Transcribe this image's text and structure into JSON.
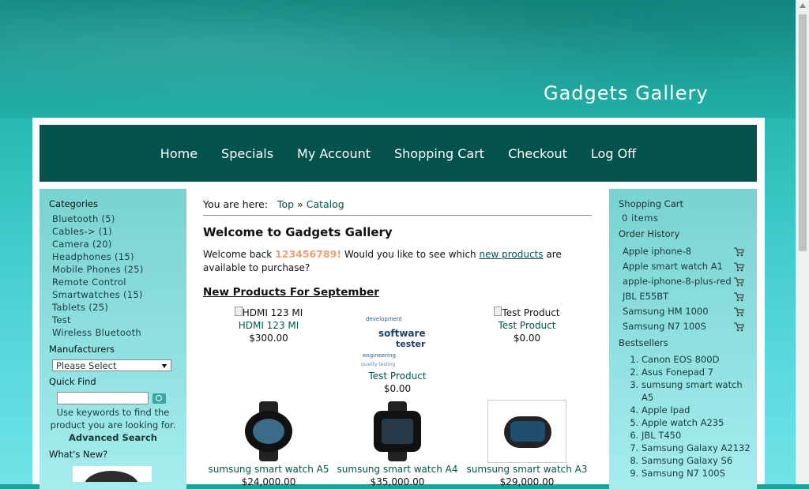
{
  "site": {
    "title": "Gadgets Gallery"
  },
  "nav": [
    "Home",
    "Specials",
    "My Account",
    "Shopping Cart",
    "Checkout",
    "Log Off"
  ],
  "left": {
    "categories_title": "Categories",
    "categories": [
      "Bluetooth (5)",
      "Cables-> (1)",
      "Camera (20)",
      "Headphones (15)",
      "Mobile Phones (25)",
      "Remote Control",
      "Smartwatches (15)",
      "Tablets (25)",
      "Test",
      "Wireless Bluetooth"
    ],
    "manufacturers_title": "Manufacturers",
    "manufacturers_select": "Please Select",
    "quickfind_title": "Quick Find",
    "quickfind_text": "Use keywords to find the product you are looking for.",
    "advanced_search": "Advanced Search",
    "whats_new_title": "What's New?"
  },
  "content": {
    "breadcrumb_prefix": "You are here:",
    "breadcrumb_top": "Top",
    "breadcrumb_sep": "»",
    "breadcrumb_catalog": "Catalog",
    "heading": "Welcome to Gadgets Gallery",
    "welcome_back": "Welcome back",
    "username": "123456789!",
    "welcome_mid": "Would you like to see which",
    "new_products_link": "new products",
    "welcome_end": "are available to purchase?",
    "new_products_heading": "New Products For September",
    "products": [
      {
        "alt": "HDMI 123 MI",
        "name": "HDMI 123 MI",
        "price": "$300.00"
      },
      {
        "name": "Test Product",
        "price": "$0.00"
      },
      {
        "alt": "Test Product",
        "name": "Test Product",
        "price": "$0.00"
      },
      {
        "name": "sumsung smart watch A5",
        "price": "$24,000.00"
      },
      {
        "name": "sumsung smart watch A4",
        "price": "$35,000.00"
      },
      {
        "name": "sumsung smart watch A3",
        "price": "$29,000.00"
      }
    ]
  },
  "right": {
    "cart_title": "Shopping Cart",
    "cart_items": "0 items",
    "order_history_title": "Order History",
    "order_history": [
      "Apple iphone-8",
      "Apple smart watch A1",
      "apple-iphone-8-plus-red",
      "JBL E55BT",
      "Samsung HM 1000",
      "Samsung N7 100S"
    ],
    "bestsellers_title": "Bestsellers",
    "bestsellers": [
      "Canon EOS 800D",
      "Asus Fonepad 7",
      "sumsung smart watch A5",
      "Apple Ipad",
      "Apple watch A235",
      "JBL T450",
      "Samsung Galaxy A2132",
      "Samsung Galaxy S6",
      "Samsung N7 100S"
    ]
  }
}
